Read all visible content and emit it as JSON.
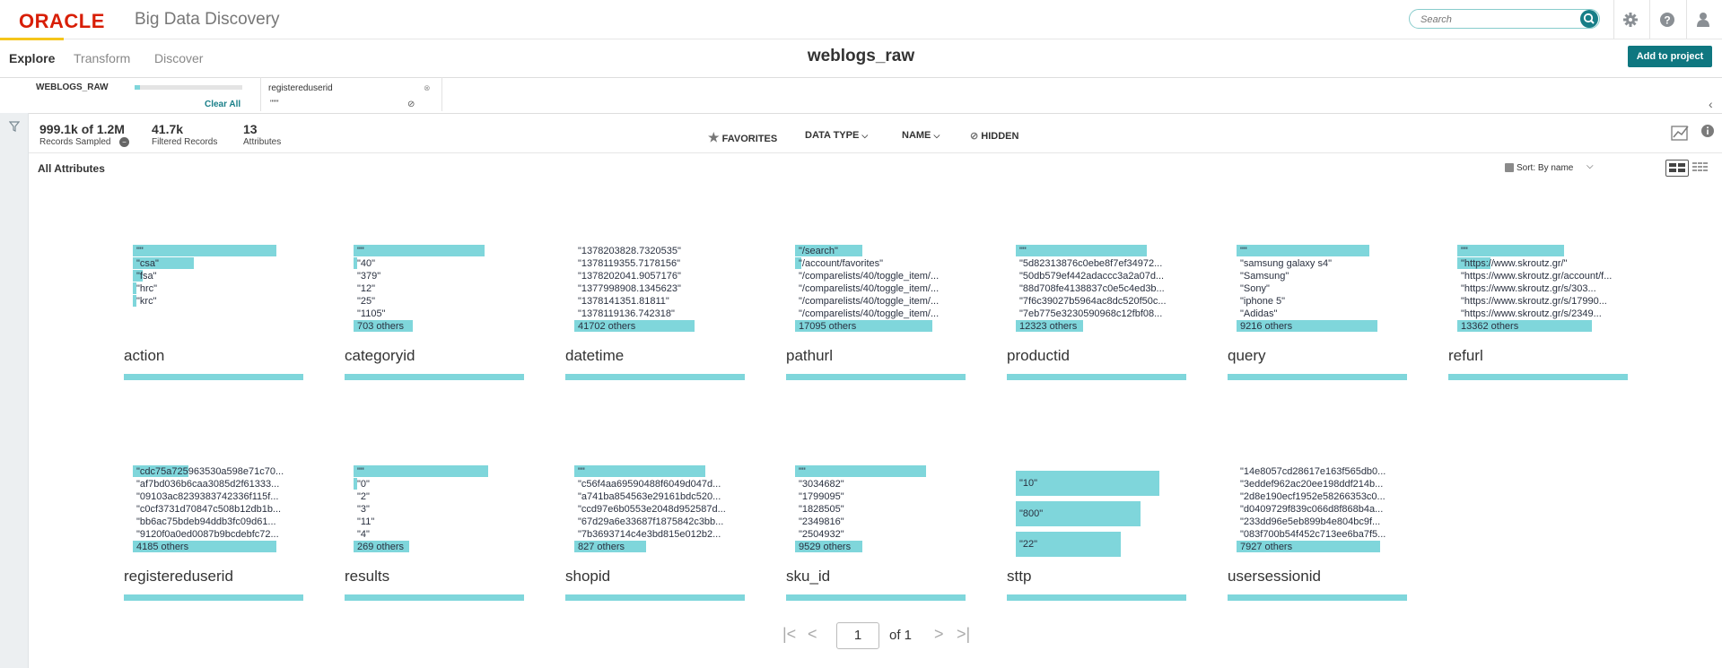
{
  "header": {
    "brand": "ORACLE",
    "product": "Big Data Discovery",
    "search_placeholder": "Search"
  },
  "tabs": [
    {
      "label": "Explore",
      "active": true
    },
    {
      "label": "Transform",
      "active": false
    },
    {
      "label": "Discover",
      "active": false
    }
  ],
  "page_title": "weblogs_raw",
  "add_to_project_label": "Add to project",
  "refinement": {
    "dataset_label": "WEBLOGS_RAW",
    "clear_all_label": "Clear All",
    "attribute": "registereduserid",
    "value": "\"\"\""
  },
  "stats": {
    "records_value": "999.1k of 1.2M",
    "records_label": "Records Sampled",
    "filtered_value": "41.7k",
    "filtered_label": "Filtered Records",
    "attributes_value": "13",
    "attributes_label": "Attributes"
  },
  "controls": {
    "favorites": "FAVORITES",
    "data_type": "DATA TYPE",
    "name": "NAME",
    "hidden": "HIDDEN"
  },
  "section_title": "All Attributes",
  "sort_label": "Sort:  By name",
  "pagination": {
    "current_page": "1",
    "of_label": "of 1"
  },
  "colors": {
    "accent": "#7fd6db",
    "primary_button": "#0f7780",
    "oracle_red": "#d81e05",
    "tab_underline": "#f5c51b"
  },
  "attributes": [
    {
      "name": "action",
      "values": [
        "\"\"",
        "\"csa\"",
        "\"fsa\"",
        "\"hrc\"",
        "\"krc\""
      ],
      "fills": [
        0.9,
        0.38,
        0.06,
        0.02,
        0.02
      ],
      "others": ""
    },
    {
      "name": "categoryid",
      "values": [
        "\"\"",
        "\"40\"",
        "\"379\"",
        "\"12\"",
        "\"25\"",
        "\"1105\""
      ],
      "fills": [
        0.82,
        0.02,
        0.0,
        0.0,
        0.0,
        0.0
      ],
      "others": "703 others",
      "others_fill": 0.37
    },
    {
      "name": "datetime",
      "values": [
        "\"1378203828.7320535\"",
        "\"1378119355.7178156\"",
        "\"1378202041.9057176\"",
        "\"1377998908.1345623\"",
        "\"1378141351.81811\"",
        "\"1378119136.742318\""
      ],
      "fills": [
        0,
        0,
        0,
        0,
        0,
        0
      ],
      "others": "41702 others",
      "others_fill": 0.75
    },
    {
      "name": "pathurl",
      "values": [
        "\"/search\"",
        "\"/account/favorites\"",
        "\"/comparelists/40/toggle_item/...",
        "\"/comparelists/40/toggle_item/...",
        "\"/comparelists/40/toggle_item/...",
        "\"/comparelists/40/toggle_item/..."
      ],
      "fills": [
        0.42,
        0.04,
        0.0,
        0.0,
        0.0,
        0.0
      ],
      "others": "17095 others",
      "others_fill": 0.86
    },
    {
      "name": "productid",
      "values": [
        "\"\"",
        "\"5d82313876c0ebe8f7ef34972...",
        "\"50db579ef442adaccc3a2a07d...",
        "\"88d708fe4138837c0e5c4ed3b...",
        "\"7f6c39027b5964ac8dc520f50c...",
        "\"7eb775e3230590968c12fbf08..."
      ],
      "fills": [
        0.82,
        0.0,
        0.0,
        0.0,
        0.0,
        0.0
      ],
      "others": "12323 others",
      "others_fill": 0.42
    },
    {
      "name": "query",
      "values": [
        "\"\"",
        "\"samsung galaxy s4\"",
        "\"Samsung\"",
        "\"Sony\"",
        "\"iphone 5\"",
        "\"Adidas\""
      ],
      "fills": [
        0.83,
        0.0,
        0.0,
        0.0,
        0.0,
        0.0
      ],
      "others": "9216 others",
      "others_fill": 0.88
    },
    {
      "name": "refurl",
      "values": [
        "\"\"",
        "\"https://www.skroutz.gr/\"",
        "\"https://www.skroutz.gr/account/f...",
        "\"https://www.skroutz.gr/s/303...",
        "\"https://www.skroutz.gr/s/17990...",
        "\"https://www.skroutz.gr/s/2349..."
      ],
      "fills": [
        0.67,
        0.21,
        0.0,
        0.0,
        0.0,
        0.0
      ],
      "others": "13362 others",
      "others_fill": 0.84
    },
    {
      "name": "registereduserid",
      "values": [
        "\"cdc75a725963530a598e71c70...",
        "\"af7bd036b6caa3085d2f61333...",
        "\"09103ac8239383742336f115f...",
        "\"c0cf3731d70847c508b12db1b...",
        "\"bb6ac75bdeb94ddb3fc09d61...",
        "\"9120f0a0ed0087b9bcdebfc72..."
      ],
      "fills": [
        0.35,
        0.0,
        0.0,
        0.0,
        0.0,
        0.0
      ],
      "others": "4185 others",
      "others_fill": 0.9
    },
    {
      "name": "results",
      "values": [
        "\"\"",
        "\"0\"",
        "\"2\"",
        "\"3\"",
        "\"11\"",
        "\"4\""
      ],
      "fills": [
        0.84,
        0.02,
        0.0,
        0.0,
        0.0,
        0.0
      ],
      "others": "269 others",
      "others_fill": 0.35
    },
    {
      "name": "shopid",
      "values": [
        "\"\"",
        "\"c56f4aa69590488f6049d047d...",
        "\"a741ba854563e29161bdc520...",
        "\"ccd97e6b0553e2048d952587d...",
        "\"67d29a6e33687f1875842c3bb...",
        "\"7b3693714c4e3bd815e012b2..."
      ],
      "fills": [
        0.82,
        0.0,
        0.0,
        0.0,
        0.0,
        0.0
      ],
      "others": "827 others",
      "others_fill": 0.45
    },
    {
      "name": "sku_id",
      "values": [
        "\"\"",
        "\"3034682\"",
        "\"1799095\"",
        "\"1828505\"",
        "\"2349816\"",
        "\"2504932\""
      ],
      "fills": [
        0.82,
        0.0,
        0.0,
        0.0,
        0.0,
        0.0
      ],
      "others": "9529 others",
      "others_fill": 0.42
    },
    {
      "name": "sttp",
      "values": [
        "\"10\"",
        "\"800\"",
        "\"22\""
      ],
      "fills": [
        0.9,
        0.78,
        0.66
      ],
      "others": "",
      "big": true
    },
    {
      "name": "usersessionid",
      "values": [
        "\"14e8057cd28617e163f565db0...",
        "\"3eddef962ac20ee198ddf214b...",
        "\"2d8e190ecf1952e58266353c0...",
        "\"d0409729f839c066d8f868b4a...",
        "\"233dd96e5eb899b4e804bc9f...",
        "\"083f700b54f452c713ee6ba7f5..."
      ],
      "fills": [
        0,
        0,
        0,
        0,
        0,
        0
      ],
      "others": "7927 others",
      "others_fill": 0.9
    }
  ]
}
